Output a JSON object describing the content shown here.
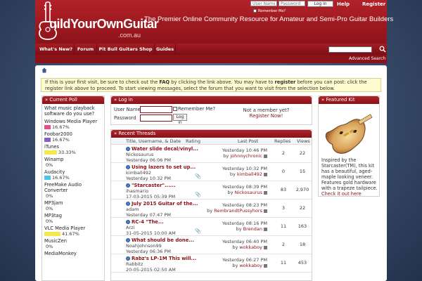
{
  "header": {
    "brand": "uildYourOwnGuitar",
    "domain": ".com.au",
    "tagline": "The Premier Online Community Resource for Amateur and Semi-Pro Guitar Builders",
    "login": {
      "username_placeholder": "User Name",
      "password_placeholder": "Password",
      "button": "Log in",
      "remember": "Remember Me?"
    },
    "links": [
      "Help",
      "Register"
    ]
  },
  "nav": {
    "tabs": [
      "What's New?",
      "Forum",
      "Pit Bull Guitars Shop",
      "Guides"
    ],
    "advanced_search": "Advanced Search"
  },
  "notice": {
    "text_1": "If this is your first visit, be sure to check out the ",
    "faq": "FAQ",
    "text_2": " by clicking the link above. You may have to ",
    "register": "register",
    "text_3": " before you can post: click the register link above to proceed. To start viewing messages, select the forum that you want to visit from the selection below."
  },
  "poll": {
    "title": "» Current Poll",
    "question": "What music playback software do you use?",
    "options": [
      {
        "label": "Windows Media Player",
        "pct": "16.67%",
        "value": 16.67,
        "color": "#e84a8c"
      },
      {
        "label": "Foobar2000",
        "pct": "16.67%",
        "value": 16.67,
        "color": "#8a5fc4"
      },
      {
        "label": "iTunes",
        "pct": "33.33%",
        "value": 33.33,
        "color": "#f5e84a"
      },
      {
        "label": "Winamp",
        "pct": "0%",
        "value": 0,
        "color": "#cccccc"
      },
      {
        "label": "Audacity",
        "pct": "16.67%",
        "value": 16.67,
        "color": "#4ac4e8"
      },
      {
        "label": "FreeMake Audio Converter",
        "pct": "0%",
        "value": 0,
        "color": "#cccccc"
      },
      {
        "label": "MP3jam",
        "pct": "0%",
        "value": 0,
        "color": "#cccccc"
      },
      {
        "label": "MP3tag",
        "pct": "0%",
        "value": 0,
        "color": "#cccccc"
      },
      {
        "label": "VLC Media Player",
        "pct": "41.67%",
        "value": 41.67,
        "color": "#f5e84a"
      },
      {
        "label": "MusicZen",
        "pct": "0%",
        "value": 0,
        "color": "#cccccc"
      },
      {
        "label": "MediaMonkey",
        "pct": "",
        "value": 0,
        "color": "#cccccc"
      }
    ]
  },
  "login_block": {
    "title": "» Log in",
    "user_label": "User Name",
    "pass_label": "Password",
    "remember": "Remember Me?",
    "button": "Log in",
    "not_member": "Not a member yet?",
    "register_now": "Register Now!"
  },
  "threads": {
    "title": "» Recent Threads",
    "headers": [
      "Title, Username, & Date",
      "Rating",
      "Last Post",
      "Replies",
      "Views"
    ],
    "rows": [
      {
        "title": "Water slide decal/vinyl...",
        "user": "Nickosaurus",
        "date": "Yesterday 06:06 PM",
        "lp_time": "Yesterday 10:46 PM",
        "lp_user": "johnnychronic",
        "replies": "2",
        "views": "22",
        "clip": ""
      },
      {
        "title": "Using lazers to set up...",
        "user": "kimball492",
        "date": "Yesterday 10:32 PM",
        "lp_time": "Yesterday 10:32 PM",
        "lp_user": "kimball492",
        "replies": "0",
        "views": "15",
        "clip": "📎"
      },
      {
        "title": "\"Starcaster\"......",
        "user": "ihasmario",
        "date": "17-03-2015 05:39 PM",
        "lp_time": "Yesterday 08:39 PM",
        "lp_user": "Nickosaurus",
        "replies": "83",
        "views": "2,970",
        "clip": "📎"
      },
      {
        "title": "July 2015 Guitar of the...",
        "user": "adam",
        "date": "Yesterday 07:47 PM",
        "lp_time": "Yesterday 08:23 PM",
        "lp_user": "RembrandtPussyhors",
        "replies": "3",
        "views": "22",
        "clip": ""
      },
      {
        "title": "RC-4 \"The...",
        "user": "Arzi",
        "date": "31-05-2015 10:00 AM",
        "lp_time": "Yesterday 08:16 PM",
        "lp_user": "Brendan",
        "replies": "11",
        "views": "163",
        "clip": "📎"
      },
      {
        "title": "What should be done...",
        "user": "Noahjohnson99",
        "date": "Yesterday 06:36 PM",
        "lp_time": "Yesterday 06:40 PM",
        "lp_user": "wokkaboy",
        "replies": "2",
        "views": "18",
        "clip": ""
      },
      {
        "title": "Rabz's LP-1M This will...",
        "user": "Rabbitz",
        "date": "20-05-2015 02:50 AM",
        "lp_time": "Yesterday 06:27 PM",
        "lp_user": "wokkaboy",
        "replies": "11",
        "views": "453",
        "clip": ""
      }
    ]
  },
  "featured": {
    "title": "» Featured Kit",
    "desc": "Inspired by the Starcaster(TM), this kit has a beautiful, aged-maple looking veneer. Features gold hardware with a trapeze tailpiece.",
    "link": "Check it out here"
  }
}
